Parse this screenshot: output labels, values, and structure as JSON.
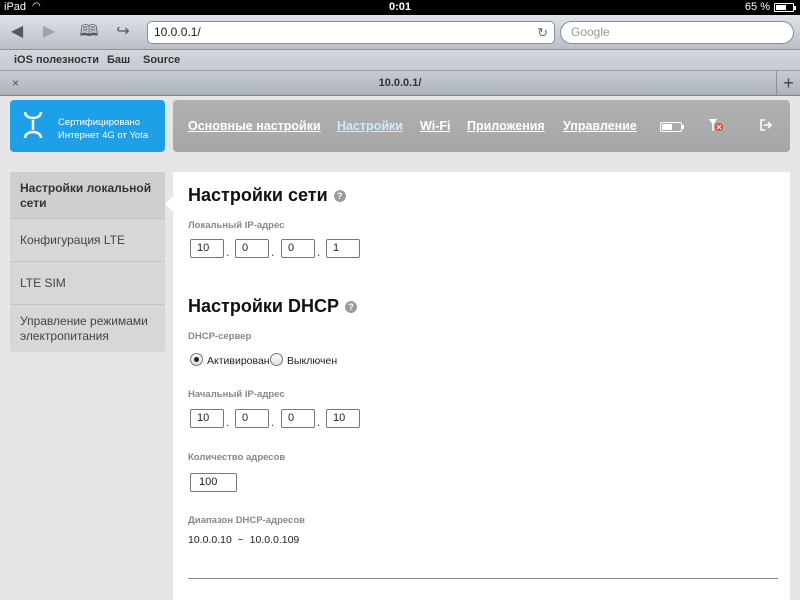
{
  "status_bar": {
    "device": "iPad",
    "time": "0:01",
    "battery": "65 %",
    "battery_level": 0.65
  },
  "browser": {
    "url": "10.0.0.1/",
    "search_placeholder": "Google",
    "bookmarks": [
      "iOS полезности",
      "Баш",
      "Source"
    ],
    "tab_title": "10.0.0.1/",
    "new_tab_label": "+",
    "tab_close_label": "×"
  },
  "logo": {
    "line1": "Сертифицировано",
    "line2": "Интернет 4G от Yota"
  },
  "nav": {
    "items": [
      "Основные настройки",
      "Настройки",
      "Wi-Fi",
      "Приложения",
      "Управление"
    ],
    "active_index": 1,
    "battery_level": 0.55
  },
  "sidebar": {
    "items": [
      "Настройки локальной сети",
      "Конфигурация LTE",
      "LTE SIM",
      "Управление режимами электропитания"
    ],
    "active_index": 0
  },
  "network": {
    "title": "Настройки сети",
    "ip_label": "Локальный IP-адрес",
    "ip": [
      "10",
      "0",
      "0",
      "1"
    ]
  },
  "dhcp": {
    "title": "Настройки DHCP",
    "server_label": "DHCP-сервер",
    "option_on": "Активирован",
    "option_off": "Выключен",
    "selected": "on",
    "start_label": "Начальный IP-адрес",
    "start_ip": [
      "10",
      "0",
      "0",
      "10"
    ],
    "count_label": "Количество адресов",
    "count": "100",
    "range_label": "Диапазон DHCP-адресов",
    "range_start": "10.0.0.10",
    "range_sep": "~",
    "range_end": "10.0.0.109"
  },
  "help_glyph": "?"
}
